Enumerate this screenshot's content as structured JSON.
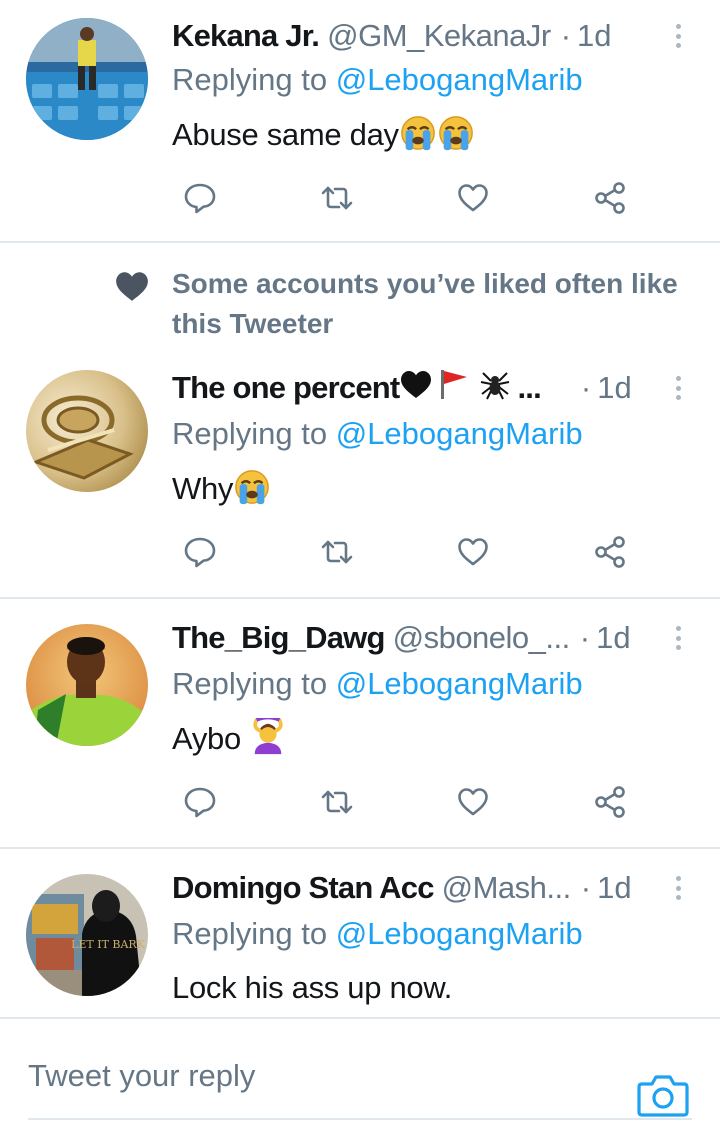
{
  "tweets": [
    {
      "name": "Kekana Jr.",
      "handle": "@GM_KekanaJr",
      "sep": "·",
      "time": "1d",
      "reply_label": "Replying to ",
      "reply_mention": "@LebogangMarib",
      "text": "Abuse same day",
      "emojis": [
        "loudly-crying-face",
        "loudly-crying-face"
      ]
    },
    {
      "name": "The one percent",
      "name_emojis": [
        "black-heart",
        "red-flag",
        "spider"
      ],
      "name_ellipsis": "...",
      "sep": "·",
      "time": "1d",
      "reply_label": "Replying to ",
      "reply_mention": "@LebogangMarib",
      "text": "Why",
      "emojis": [
        "loudly-crying-face"
      ]
    },
    {
      "name": "The_Big_Dawg",
      "handle": "@sbonelo_...",
      "sep": "·",
      "time": "1d",
      "reply_label": "Replying to ",
      "reply_mention": "@LebogangMarib",
      "text": "Aybo ",
      "emojis": [
        "woman-gesturing-ok"
      ]
    },
    {
      "name": "Domingo Stan Acc",
      "handle": "@Mash...",
      "sep": "·",
      "time": "1d",
      "reply_label": "Replying to ",
      "reply_mention": "@LebogangMarib",
      "text": "Lock his ass up now.",
      "avatar_text": "LET IT BARK"
    }
  ],
  "social_context": {
    "text": "Some accounts you’ve liked often like this Tweeter",
    "icon": "heart-icon"
  },
  "actions": [
    "reply-icon",
    "retweet-icon",
    "like-icon",
    "share-icon"
  ],
  "composer": {
    "placeholder": "Tweet your reply",
    "camera_icon": "camera-icon"
  },
  "colors": {
    "accent": "#1da1f2",
    "secondary_text": "#657786",
    "icon": "#657786",
    "divider": "#e1e8ed"
  }
}
